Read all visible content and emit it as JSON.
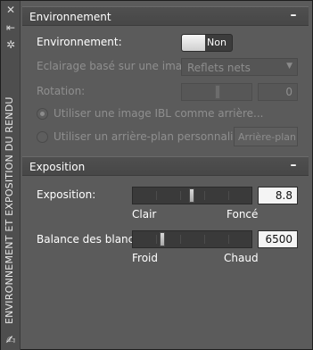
{
  "window": {
    "vertical_title": "ENVIRONNEMENT ET EXPOSITION DU RENDU",
    "icons": [
      "close-icon",
      "pin-icon",
      "settings-icon",
      "resize-icon"
    ]
  },
  "environment": {
    "header": "Environnement",
    "collapse_symbol": "–",
    "toggle_label": "Environnement:",
    "toggle_state": "Non",
    "ibl_label": "Eclairage basé sur une image:",
    "ibl_value": "Reflets nets",
    "rotation_label": "Rotation:",
    "rotation_value": "0",
    "radio_ibl_background": "Utiliser une image IBL comme arrière...",
    "radio_custom_background": "Utiliser un arrière-plan personnalisé",
    "background_button": "Arrière-plan..."
  },
  "exposure": {
    "header": "Exposition",
    "collapse_symbol": "–",
    "exposure_label": "Exposition:",
    "exposure_value": "8.8",
    "exposure_slider_fraction": 0.5,
    "exposure_min_label": "Clair",
    "exposure_max_label": "Foncé",
    "white_balance_label": "Balance des blancs:",
    "white_balance_value": "6500",
    "white_balance_slider_fraction": 0.24,
    "white_balance_min_label": "Froid",
    "white_balance_max_label": "Chaud"
  }
}
